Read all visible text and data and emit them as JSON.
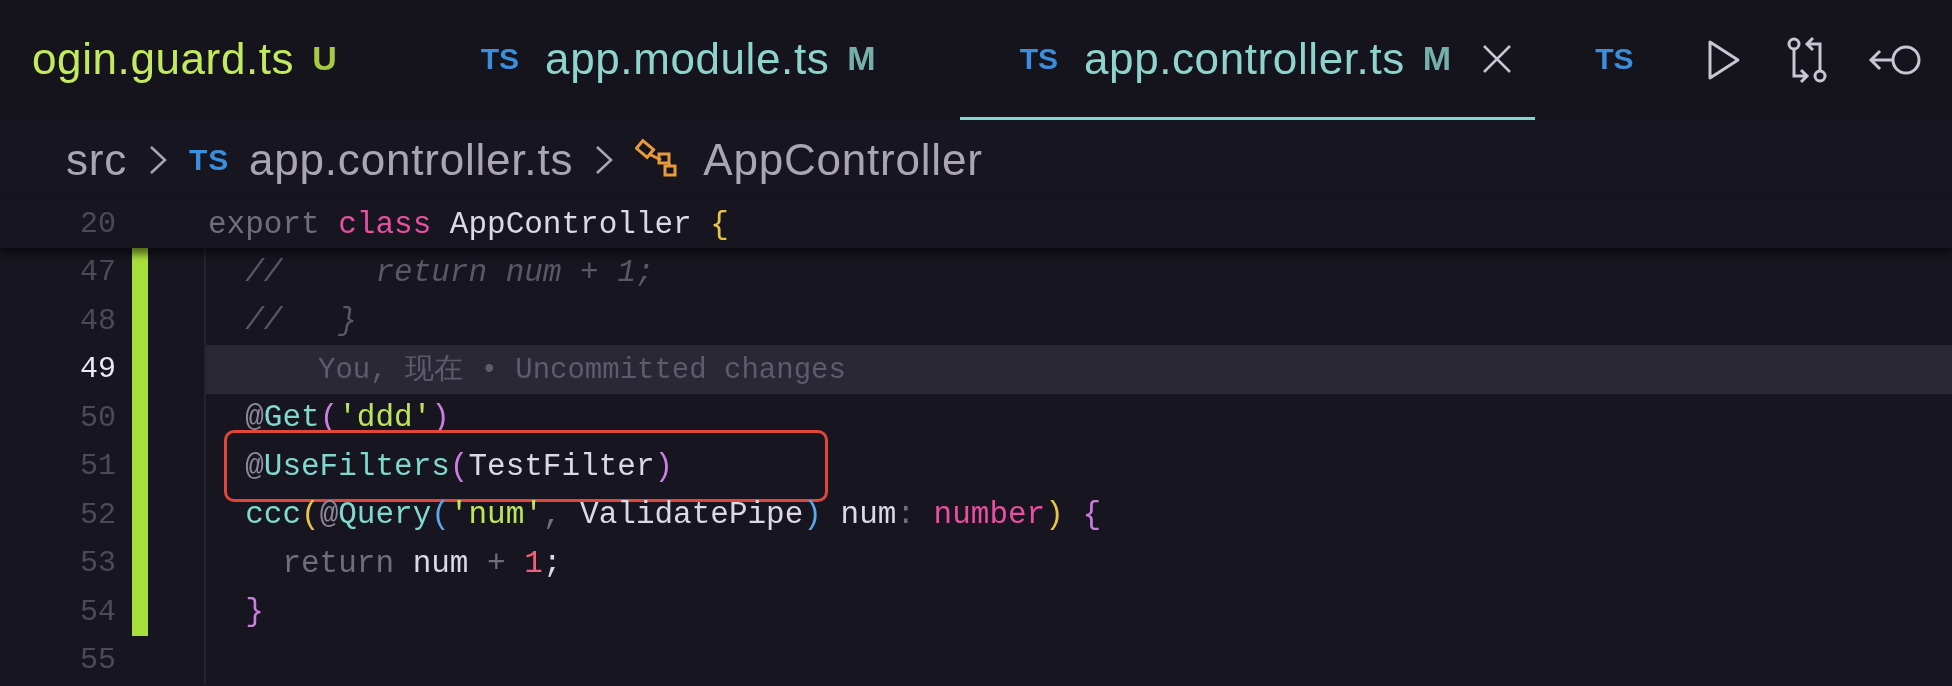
{
  "tabs": [
    {
      "name": "ogin.guard.ts",
      "status": "U",
      "selected": false
    },
    {
      "icon_label": "TS",
      "name": "app.module.ts",
      "status": "M",
      "selected": false
    },
    {
      "icon_label": "TS",
      "name": "app.controller.ts",
      "status": "M",
      "selected": true
    },
    {
      "icon_label": "TS",
      "selected": false
    }
  ],
  "breadcrumb": [
    {
      "kind": "folder",
      "label": "src"
    },
    {
      "kind": "file",
      "icon_label": "TS",
      "label": "app.controller.ts"
    },
    {
      "kind": "class",
      "label": "AppController"
    }
  ],
  "sticky_line": {
    "number": "20",
    "tokens": [
      {
        "kind": "muted",
        "text": "export "
      },
      {
        "kind": "keyword",
        "text": "class "
      },
      {
        "kind": "name",
        "text": "AppController "
      },
      {
        "kind": "brace-y",
        "text": "{"
      }
    ]
  },
  "lines": [
    {
      "number": "47",
      "modified": true,
      "current": false,
      "boxed": false,
      "tokens": [
        {
          "kind": "comment",
          "text": "  //     return num + 1;"
        }
      ]
    },
    {
      "number": "48",
      "modified": true,
      "current": false,
      "boxed": false,
      "tokens": [
        {
          "kind": "comment",
          "text": "  //   }"
        }
      ]
    },
    {
      "number": "49",
      "modified": true,
      "current": true,
      "boxed": false,
      "blame": "You, 现在 • Uncommitted changes"
    },
    {
      "number": "50",
      "modified": true,
      "current": false,
      "boxed": false,
      "tokens": [
        {
          "kind": "at",
          "text": "  @"
        },
        {
          "kind": "fn",
          "text": "Get"
        },
        {
          "kind": "brace-p",
          "text": "("
        },
        {
          "kind": "string",
          "text": "'ddd'"
        },
        {
          "kind": "brace-p",
          "text": ")"
        }
      ]
    },
    {
      "number": "51",
      "modified": true,
      "current": false,
      "boxed": true,
      "tokens": [
        {
          "kind": "at",
          "text": "  @"
        },
        {
          "kind": "fn",
          "text": "UseFilters"
        },
        {
          "kind": "brace-p",
          "text": "("
        },
        {
          "kind": "name",
          "text": "TestFilter"
        },
        {
          "kind": "brace-p",
          "text": ")"
        }
      ]
    },
    {
      "number": "52",
      "modified": true,
      "current": false,
      "boxed": false,
      "tokens": [
        {
          "kind": "fn",
          "text": "  ccc"
        },
        {
          "kind": "brace-y",
          "text": "("
        },
        {
          "kind": "at",
          "text": "@"
        },
        {
          "kind": "fn",
          "text": "Query"
        },
        {
          "kind": "brace-b",
          "text": "("
        },
        {
          "kind": "string",
          "text": "'num'"
        },
        {
          "kind": "muted",
          "text": ", "
        },
        {
          "kind": "name",
          "text": "ValidatePipe"
        },
        {
          "kind": "brace-b",
          "text": ")"
        },
        {
          "kind": "name",
          "text": " num"
        },
        {
          "kind": "muted",
          "text": ": "
        },
        {
          "kind": "keyword",
          "text": "number"
        },
        {
          "kind": "brace-y",
          "text": ")"
        },
        {
          "kind": "brace-p",
          "text": " {"
        }
      ]
    },
    {
      "number": "53",
      "modified": true,
      "current": false,
      "boxed": false,
      "tokens": [
        {
          "kind": "muted",
          "text": "    return"
        },
        {
          "kind": "name",
          "text": " num "
        },
        {
          "kind": "muted",
          "text": "+ "
        },
        {
          "kind": "number",
          "text": "1"
        },
        {
          "kind": "name",
          "text": ";"
        }
      ]
    },
    {
      "number": "54",
      "modified": true,
      "current": false,
      "boxed": false,
      "tokens": [
        {
          "kind": "brace-p",
          "text": "  }"
        }
      ]
    },
    {
      "number": "55",
      "modified": false,
      "current": false,
      "boxed": false
    }
  ]
}
